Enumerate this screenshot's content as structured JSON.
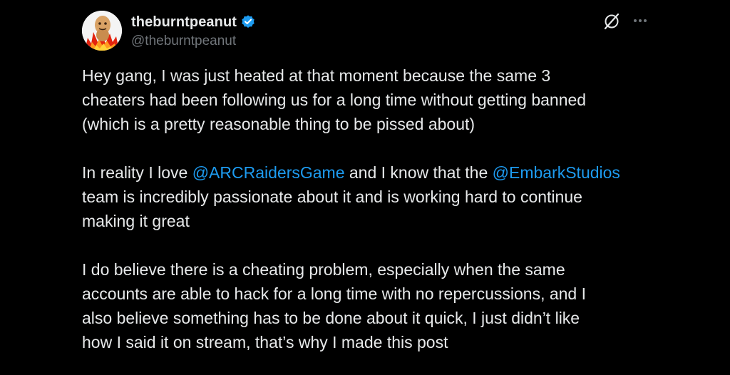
{
  "author": {
    "display_name": "theburntpeanut",
    "handle": "@theburntpeanut",
    "verified_icon": "verified-badge-icon"
  },
  "actions": {
    "grok_icon": "grok-icon",
    "more_icon": "more-icon"
  },
  "tweet": {
    "p1": "Hey gang, I was just heated at that moment because the same 3\ncheaters had been following us for a long time without getting banned\n(which is a pretty reasonable thing to be pissed about)",
    "p2_a": "In reality I love ",
    "mention1": "@ARCRaidersGame",
    "p2_b": " and I know that the ",
    "mention2": "@EmbarkStudios",
    "p2_c": "\nteam is incredibly passionate about it and is working hard to continue\nmaking it great",
    "p3": "I do believe there is a cheating problem, especially when the same\naccounts are able to hack for a long time with no repercussions, and I\nalso believe something has to be done about it quick, I just didn’t like\nhow I said it on stream, that’s why I made this post"
  },
  "colors": {
    "background": "#000000",
    "text": "#e7e9ea",
    "secondary": "#71767b",
    "accent": "#1d9bf0"
  }
}
